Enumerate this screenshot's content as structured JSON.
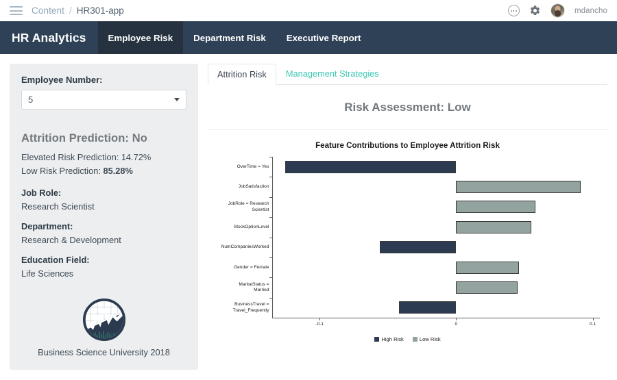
{
  "topbar": {
    "menu_icon": "hamburger-icon",
    "breadcrumb_root": "Content",
    "breadcrumb_sep": "/",
    "breadcrumb_current": "HR301-app",
    "more_icon": "ellipsis-circle-icon",
    "settings_icon": "gear-icon",
    "user_name": "mdancho"
  },
  "navbar": {
    "brand": "HR Analytics",
    "tabs": [
      {
        "label": "Employee Risk",
        "active": true
      },
      {
        "label": "Department Risk",
        "active": false
      },
      {
        "label": "Executive Report",
        "active": false
      }
    ]
  },
  "sidebar": {
    "employee_number_label": "Employee Number:",
    "employee_number_value": "5",
    "dropdown_icon": "chevron-down-icon",
    "attrition_prediction": "Attrition Prediction: No",
    "elevated_risk_label": "Elevated Risk Prediction: ",
    "elevated_risk_value": "14.72%",
    "low_risk_label": "Low Risk Prediction: ",
    "low_risk_value": "85.28%",
    "job_role_label": "Job Role:",
    "job_role_value": "Research Scientist",
    "department_label": "Department:",
    "department_value": "Research & Development",
    "education_field_label": "Education Field:",
    "education_field_value": "Life Sciences",
    "logo_icon": "business-science-university-logo",
    "logo_caption": "Business Science University 2018"
  },
  "main": {
    "tabs": [
      {
        "label": "Attrition Risk",
        "active": true
      },
      {
        "label": "Management Strategies",
        "active": false
      }
    ],
    "assessment": "Risk Assessment: Low"
  },
  "colors": {
    "navbar_bg": "#2f4157",
    "navbar_active": "#26323f",
    "sidebar_bg": "#eceeef",
    "link_teal": "#3ec9b5",
    "high_risk": "#2c3a52",
    "low_risk": "#93a3a0"
  },
  "chart_data": {
    "type": "bar",
    "orientation": "horizontal",
    "title": "Feature Contributions to Employee Attrition Risk",
    "xlabel": "",
    "ylabel": "",
    "xlim": [
      -0.135,
      0.105
    ],
    "xticks": [
      -0.1,
      0,
      0.1
    ],
    "xticklabels": [
      "-0.1",
      "0",
      "0.1"
    ],
    "grid": false,
    "legend_position": "bottom",
    "legend": [
      {
        "name": "High Risk",
        "color": "#2c3a52"
      },
      {
        "name": "Low Risk",
        "color": "#93a3a0"
      }
    ],
    "categories": [
      "OverTime = Yes",
      "JobSatisfaction",
      "JobRole = Research\nScientist",
      "StockOptionLevel",
      "NumCompaniesWorked",
      "Gender = Female",
      "MaritalStatus =\nMarried",
      "BusinessTravel =\nTravel_Frequently"
    ],
    "values": [
      -0.125,
      0.091,
      0.058,
      0.055,
      -0.056,
      0.046,
      0.045,
      -0.042
    ],
    "series": [
      {
        "name": "Feature Contribution",
        "values": [
          -0.125,
          0.091,
          0.058,
          0.055,
          -0.056,
          0.046,
          0.045,
          -0.042
        ],
        "risk": [
          "High Risk",
          "Low Risk",
          "Low Risk",
          "Low Risk",
          "High Risk",
          "Low Risk",
          "Low Risk",
          "High Risk"
        ]
      }
    ]
  }
}
